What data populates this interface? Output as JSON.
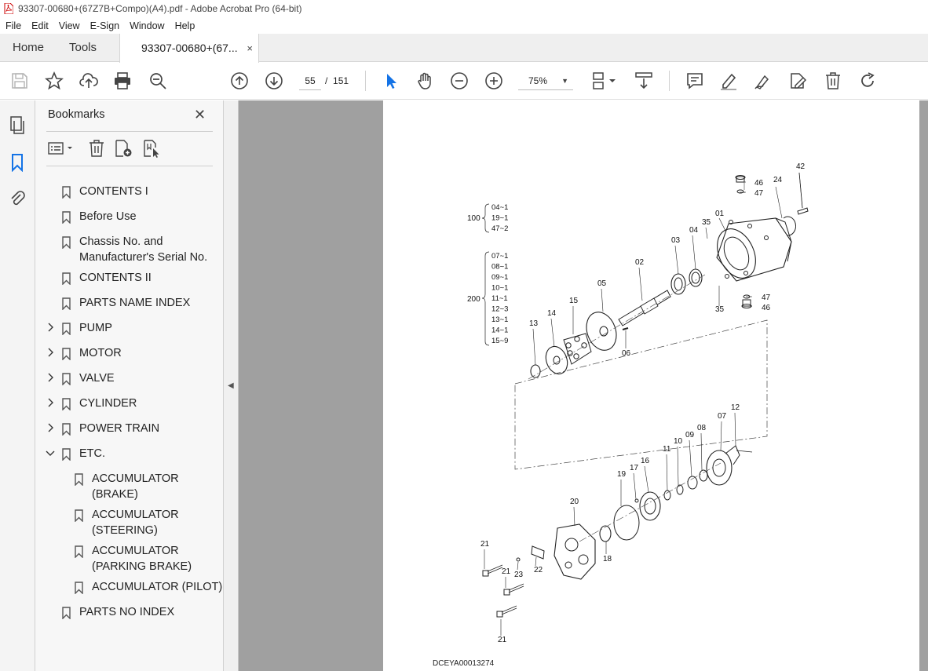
{
  "window": {
    "title": "93307-00680+(67Z7B+Compo)(A4).pdf - Adobe Acrobat Pro (64-bit)"
  },
  "menu": [
    "File",
    "Edit",
    "View",
    "E-Sign",
    "Window",
    "Help"
  ],
  "tabs": {
    "home": "Home",
    "tools": "Tools",
    "document": "93307-00680+(67...",
    "close": "×"
  },
  "toolbar": {
    "page_current": "55",
    "page_separator": "/",
    "page_total": "151",
    "zoom": "75%"
  },
  "bookmarks": {
    "title": "Bookmarks",
    "close": "✕",
    "items": [
      {
        "label": "CONTENTS I"
      },
      {
        "label": "Before Use"
      },
      {
        "label": "Chassis No. and",
        "label2": "Manufacturer's Serial No."
      },
      {
        "label": "CONTENTS II"
      },
      {
        "label": "PARTS NAME INDEX"
      },
      {
        "label": "PUMP",
        "expandable": true
      },
      {
        "label": "MOTOR",
        "expandable": true
      },
      {
        "label": "VALVE",
        "expandable": true
      },
      {
        "label": "CYLINDER",
        "expandable": true
      },
      {
        "label": "POWER TRAIN",
        "expandable": true
      },
      {
        "label": "ETC.",
        "expanded": true
      },
      {
        "label": "ACCUMULATOR",
        "label2": "(BRAKE)"
      },
      {
        "label": "ACCUMULATOR",
        "label2": "(STEERING)"
      },
      {
        "label": "ACCUMULATOR",
        "label2": "(PARKING BRAKE)"
      },
      {
        "label": "ACCUMULATOR (PILOT)"
      },
      {
        "label": "PARTS NO INDEX"
      }
    ]
  },
  "drawing": {
    "doc_id": "DCEYA00013274",
    "group100": {
      "label": "100",
      "parts": [
        "04~1",
        "19~1",
        "47~2"
      ]
    },
    "group200": {
      "label": "200",
      "parts": [
        "07~1",
        "08~1",
        "09~1",
        "10~1",
        "11~1",
        "12~3",
        "13~1",
        "14~1",
        "15~9"
      ]
    },
    "callouts": [
      "42",
      "46",
      "47",
      "24",
      "01",
      "35",
      "04",
      "03",
      "02",
      "05",
      "15",
      "14",
      "13",
      "06",
      "47",
      "46",
      "35",
      "12",
      "07",
      "08",
      "09",
      "10",
      "11",
      "16",
      "17",
      "19",
      "20",
      "18",
      "21",
      "21",
      "22",
      "23",
      "21"
    ]
  },
  "icons": {
    "save": "save-icon",
    "star": "star-icon",
    "upload": "upload-icon",
    "print": "print-icon",
    "search": "zoom-search-icon",
    "prev": "prev-page-icon",
    "next": "next-page-icon",
    "select": "select-cursor-icon",
    "hand": "hand-icon",
    "zoom_out": "zoom-out-icon",
    "zoom_in": "zoom-in-icon"
  }
}
